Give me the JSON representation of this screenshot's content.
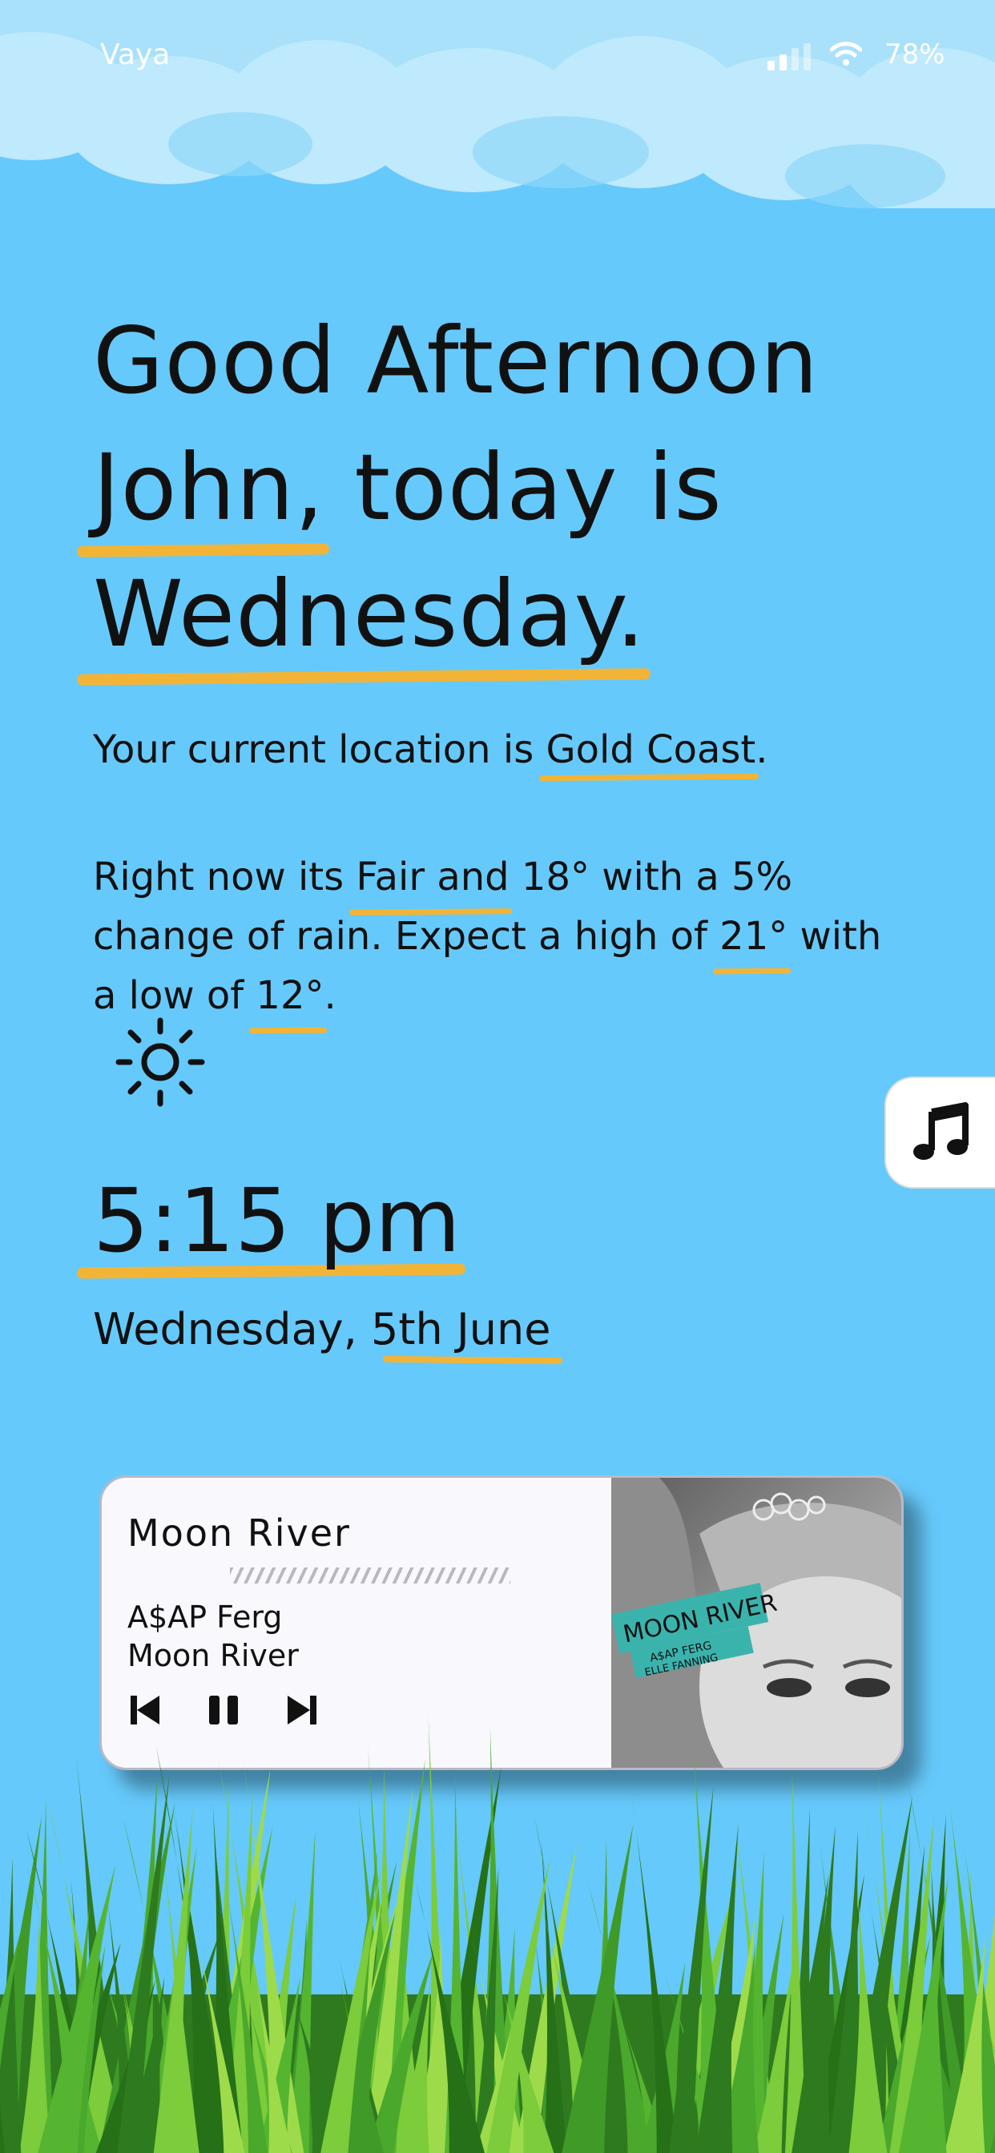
{
  "status_bar": {
    "carrier": "Vaya",
    "battery": "78%"
  },
  "greeting": {
    "line1": "Good Afternoon",
    "name": "John,",
    "line2_rest": "today is",
    "day": "Wednesday."
  },
  "location": {
    "prefix": "Your current location is",
    "place": "Gold Coast",
    "suffix": "."
  },
  "weather": {
    "part1": "Right now its",
    "condition": "Fair and",
    "temp": "18°",
    "part2": "with a 5% change of rain. Expect a high of",
    "high": "21°",
    "part3": "with a low of",
    "low": "12°",
    "part4": ".",
    "icon": "sun-icon"
  },
  "clock": {
    "time": "5:15 pm",
    "date": "Wednesday, 5th June"
  },
  "player": {
    "title": "Moon River",
    "artist": "A$AP Ferg",
    "track": "Moon River",
    "cover_text": {
      "title": "MOON RIVER",
      "line1": "A$AP FERG",
      "line2": "ELLE FANNING"
    }
  },
  "colors": {
    "sky": "#66c9fb",
    "highlight": "#f2b437",
    "card": "#f8f8fd"
  }
}
